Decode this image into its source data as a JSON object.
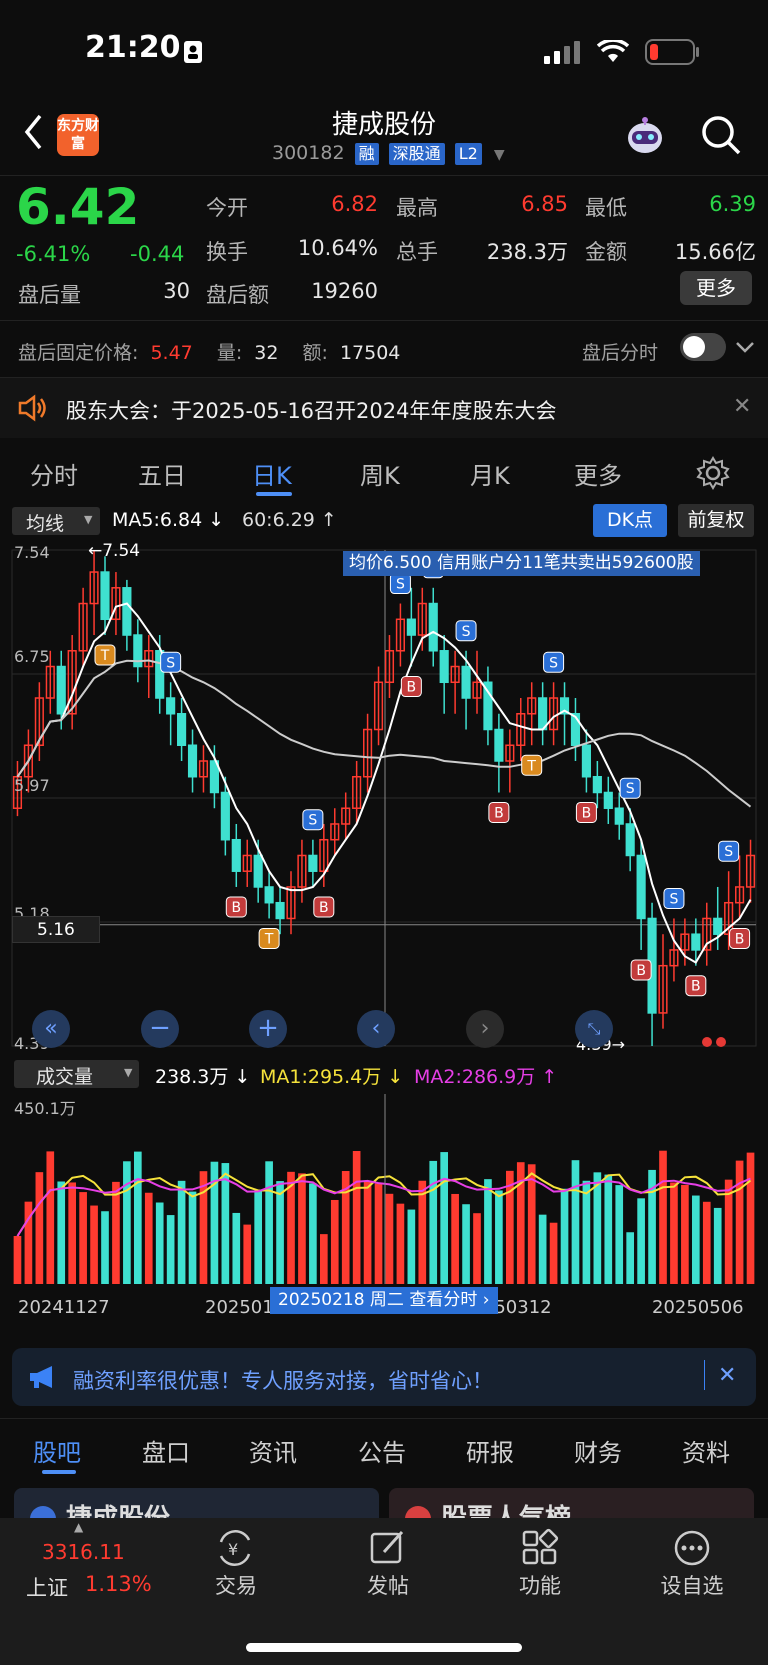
{
  "status_bar": {
    "time": "21:20"
  },
  "header": {
    "logo_text": "东方财富",
    "title": "捷成股份",
    "code": "300182",
    "tags": [
      "融",
      "深股通",
      "L2"
    ]
  },
  "quote": {
    "price": "6.42",
    "change_pct": "-6.41%",
    "change": "-0.44",
    "after_hours_volume_label": "盘后量",
    "after_hours_volume": "30",
    "stats": [
      {
        "label": "今开",
        "value": "6.82"
      },
      {
        "label": "最高",
        "value": "6.85"
      },
      {
        "label": "最低",
        "value": "6.39"
      },
      {
        "label": "换手",
        "value": "10.64%"
      },
      {
        "label": "总手",
        "value": "238.3万"
      },
      {
        "label": "金额",
        "value": "15.66亿"
      },
      {
        "label": "盘后额",
        "value": "19260"
      }
    ],
    "more_label": "更多"
  },
  "after_hours": {
    "price_label": "盘后固定价格:",
    "price": "5.47",
    "qty_label": "量:",
    "qty": "32",
    "amt_label": "额:",
    "amt": "17504",
    "timeshare_label": "盘后分时"
  },
  "notice": {
    "text": "股东大会：于2025-05-16召开2024年年度股东大会"
  },
  "kline_tabs": [
    "分时",
    "五日",
    "日K",
    "周K",
    "月K",
    "更多"
  ],
  "kline_active": "日K",
  "indicator_bar": {
    "select": "均线",
    "ma5": "MA5:6.84",
    "ma60": "60:6.29",
    "dk_button": "DK点",
    "adjust_button": "前复权"
  },
  "price_axis": {
    "labels": [
      "7.54",
      "6.75",
      "5.97",
      "5.18",
      "4.39"
    ],
    "crosshair_value": "5.16"
  },
  "chart_annotations": {
    "max_label": "←7.54",
    "min_label": "4.39→",
    "banner": "均价6.500 信用账户分11笔共卖出592600股"
  },
  "volume_bar": {
    "select": "成交量",
    "vol": "238.3万",
    "ma1": "MA1:295.4万",
    "ma2": "MA2:286.9万",
    "axis_top": "450.1万"
  },
  "date_axis": {
    "labels": [
      "20241127",
      "2025011",
      "20250312",
      "20250506"
    ],
    "crosshair_tip": "20250218 周二 查看分时"
  },
  "promo": {
    "text": "融资利率很优惠！专人服务对接，省时省心！"
  },
  "bottom_tabs": [
    "股吧",
    "盘口",
    "资讯",
    "公告",
    "研报",
    "财务",
    "资料"
  ],
  "bottom_tab_active": "股吧",
  "card_peek": {
    "left": "捷成股份",
    "right": "股票人气榜"
  },
  "index": {
    "value": "3316.11",
    "name": "上证",
    "pct": "1.13%"
  },
  "nav": [
    "交易",
    "发帖",
    "功能",
    "设自选"
  ],
  "colors": {
    "up": "#ff3b30",
    "down": "#3fe0d0",
    "ma5": "#ffffff",
    "ma60": "#cccccc",
    "accent": "#4e8ff6",
    "vol_ma1": "#f5e23b",
    "vol_ma2": "#e63fe6"
  },
  "chart_data": {
    "type": "candlestick",
    "ylim": [
      4.39,
      7.54
    ],
    "x_start_label": "20241127",
    "x_end_label": "20250506",
    "candles": [
      [
        5.9,
        6.1,
        6.2,
        5.85
      ],
      [
        6.1,
        6.3,
        6.4,
        6.0
      ],
      [
        6.3,
        6.6,
        6.7,
        6.2
      ],
      [
        6.6,
        6.8,
        6.9,
        6.5
      ],
      [
        6.8,
        6.5,
        6.9,
        6.4
      ],
      [
        6.5,
        6.9,
        7.0,
        6.4
      ],
      [
        6.9,
        7.2,
        7.3,
        6.8
      ],
      [
        7.2,
        7.4,
        7.54,
        7.0
      ],
      [
        7.4,
        7.1,
        7.5,
        7.0
      ],
      [
        7.1,
        7.3,
        7.4,
        7.0
      ],
      [
        7.3,
        7.0,
        7.35,
        6.9
      ],
      [
        7.0,
        6.8,
        7.1,
        6.7
      ],
      [
        6.8,
        6.9,
        7.0,
        6.6
      ],
      [
        6.9,
        6.6,
        7.0,
        6.5
      ],
      [
        6.6,
        6.5,
        6.7,
        6.3
      ],
      [
        6.5,
        6.3,
        6.6,
        6.2
      ],
      [
        6.3,
        6.1,
        6.4,
        6.0
      ],
      [
        6.1,
        6.2,
        6.3,
        6.0
      ],
      [
        6.2,
        6.0,
        6.3,
        5.9
      ],
      [
        6.0,
        5.7,
        6.1,
        5.6
      ],
      [
        5.7,
        5.5,
        5.8,
        5.4
      ],
      [
        5.5,
        5.6,
        5.7,
        5.4
      ],
      [
        5.6,
        5.4,
        5.7,
        5.3
      ],
      [
        5.4,
        5.3,
        5.5,
        5.2
      ],
      [
        5.3,
        5.2,
        5.4,
        5.1
      ],
      [
        5.2,
        5.4,
        5.5,
        5.1
      ],
      [
        5.4,
        5.6,
        5.7,
        5.3
      ],
      [
        5.6,
        5.5,
        5.7,
        5.4
      ],
      [
        5.5,
        5.7,
        5.8,
        5.4
      ],
      [
        5.7,
        5.8,
        5.9,
        5.6
      ],
      [
        5.8,
        5.9,
        6.0,
        5.7
      ],
      [
        5.9,
        6.1,
        6.2,
        5.8
      ],
      [
        6.1,
        6.4,
        6.5,
        6.0
      ],
      [
        6.4,
        6.7,
        6.8,
        6.3
      ],
      [
        6.7,
        6.9,
        7.0,
        6.6
      ],
      [
        6.9,
        7.1,
        7.2,
        6.8
      ],
      [
        7.1,
        7.0,
        7.3,
        6.8
      ],
      [
        7.0,
        7.2,
        7.3,
        6.9
      ],
      [
        7.2,
        6.9,
        7.3,
        6.8
      ],
      [
        6.9,
        6.7,
        7.0,
        6.5
      ],
      [
        6.7,
        6.8,
        6.9,
        6.5
      ],
      [
        6.8,
        6.6,
        6.9,
        6.4
      ],
      [
        6.6,
        6.7,
        6.9,
        6.5
      ],
      [
        6.7,
        6.4,
        6.8,
        6.3
      ],
      [
        6.4,
        6.2,
        6.5,
        6.0
      ],
      [
        6.2,
        6.3,
        6.4,
        6.0
      ],
      [
        6.3,
        6.5,
        6.6,
        6.2
      ],
      [
        6.5,
        6.6,
        6.7,
        6.3
      ],
      [
        6.6,
        6.4,
        6.7,
        6.3
      ],
      [
        6.4,
        6.6,
        6.7,
        6.3
      ],
      [
        6.6,
        6.5,
        6.7,
        6.3
      ],
      [
        6.5,
        6.3,
        6.6,
        6.2
      ],
      [
        6.3,
        6.1,
        6.4,
        6.0
      ],
      [
        6.1,
        6.0,
        6.2,
        5.9
      ],
      [
        6.0,
        5.9,
        6.1,
        5.8
      ],
      [
        5.9,
        5.8,
        6.0,
        5.7
      ],
      [
        5.8,
        5.6,
        5.9,
        5.5
      ],
      [
        5.6,
        5.2,
        5.7,
        5.0
      ],
      [
        5.2,
        4.6,
        5.3,
        4.39
      ],
      [
        4.6,
        4.9,
        5.1,
        4.5
      ],
      [
        4.9,
        5.0,
        5.2,
        4.8
      ],
      [
        5.0,
        5.1,
        5.2,
        4.9
      ],
      [
        5.1,
        5.0,
        5.2,
        4.9
      ],
      [
        5.0,
        5.2,
        5.3,
        4.9
      ],
      [
        5.2,
        5.1,
        5.4,
        5.0
      ],
      [
        5.1,
        5.3,
        5.5,
        5.0
      ],
      [
        5.3,
        5.4,
        5.6,
        5.2
      ],
      [
        5.4,
        5.6,
        5.7,
        5.3
      ]
    ],
    "volume_ylim": [
      0,
      450.1
    ]
  }
}
